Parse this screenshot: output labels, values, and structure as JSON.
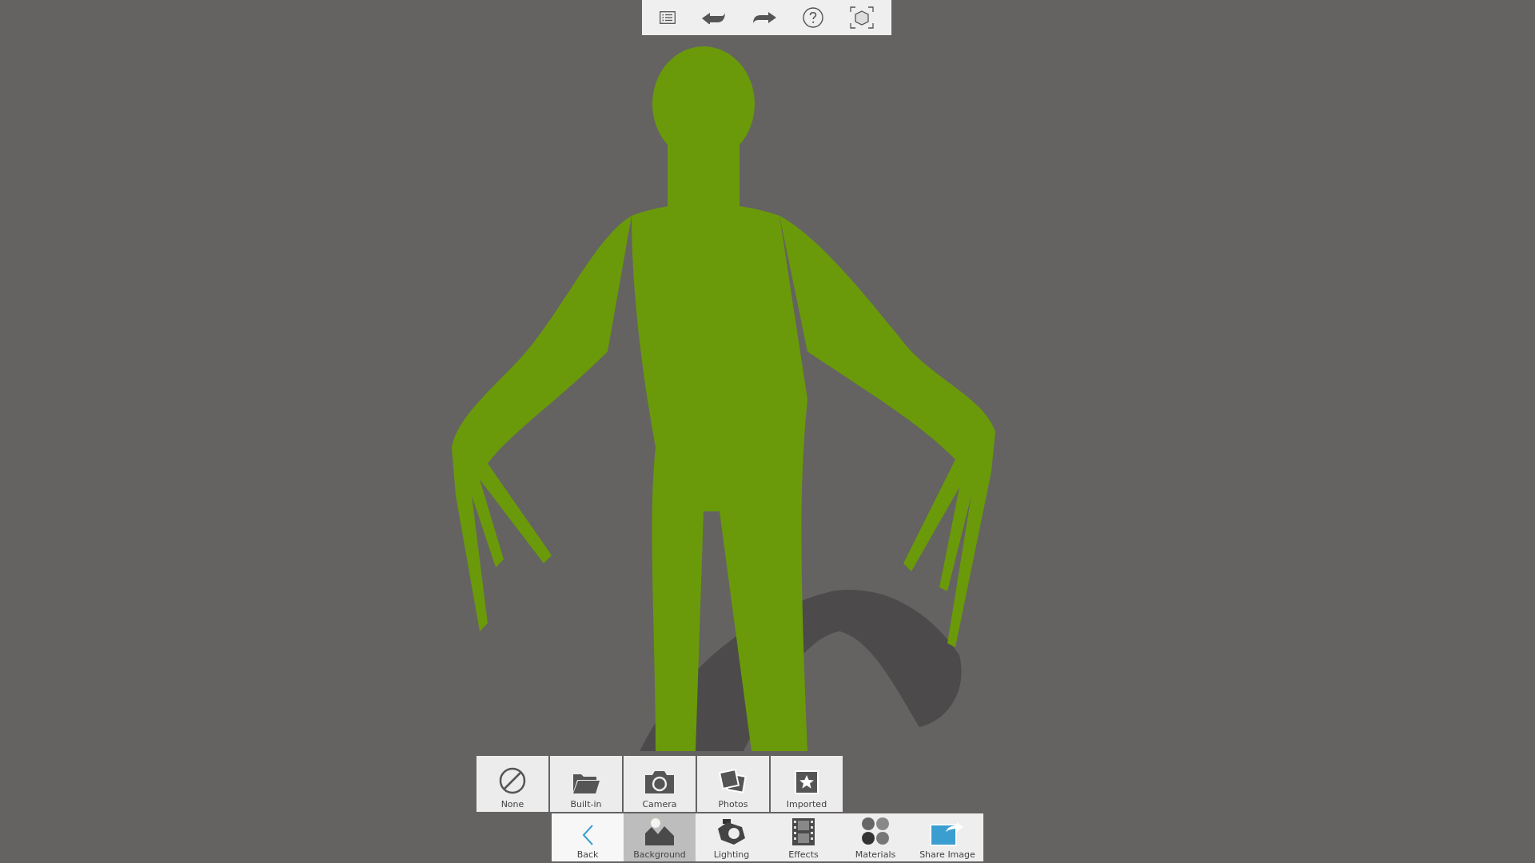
{
  "background_options": [
    {
      "kind": "none",
      "label": "None"
    },
    {
      "kind": "builtin",
      "label": "Built-in"
    },
    {
      "kind": "camera",
      "label": "Camera"
    },
    {
      "kind": "photos",
      "label": "Photos"
    },
    {
      "kind": "imported",
      "label": "Imported"
    }
  ],
  "main_bar": [
    {
      "kind": "back",
      "label": "Back",
      "selected": false
    },
    {
      "kind": "background",
      "label": "Background",
      "selected": true
    },
    {
      "kind": "lighting",
      "label": "Lighting",
      "selected": false
    },
    {
      "kind": "effects",
      "label": "Effects",
      "selected": false
    },
    {
      "kind": "materials",
      "label": "Materials",
      "selected": false
    },
    {
      "kind": "share",
      "label": "Share Image",
      "selected": false
    }
  ]
}
